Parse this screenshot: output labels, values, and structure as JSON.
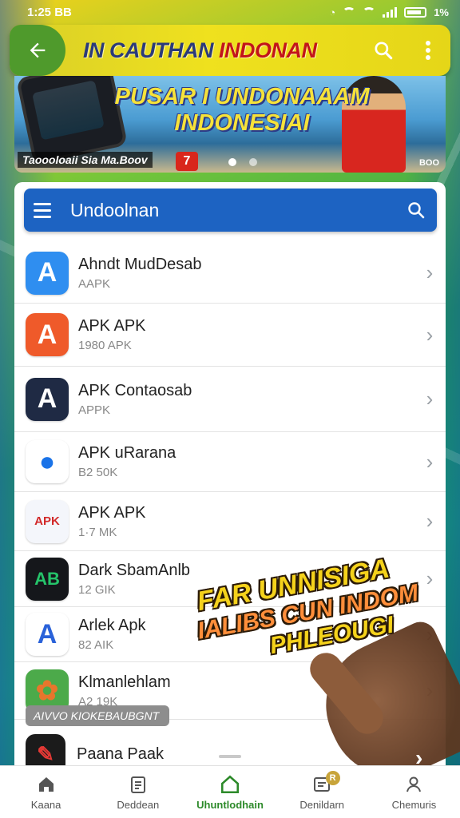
{
  "status_bar": {
    "time": "1:25 BB",
    "battery_text": "1%"
  },
  "app_bar": {
    "title_part1": "IN",
    "title_part2": " CAUTHAN ",
    "title_part3": "INDONAN",
    "back_icon": "arrow-left-icon",
    "search_icon": "search-icon",
    "more_icon": "more-vert-icon"
  },
  "banner": {
    "headline_line1": "PUSAR I UNDONAAAM",
    "headline_line2": "INDONESIAI",
    "caption": "Taoooloaii Sia Ma.Boov",
    "corner_text": "BOO",
    "logo_text": "7"
  },
  "search": {
    "title": "Undoolnan",
    "menu_icon": "menu-icon",
    "search_icon": "search-icon"
  },
  "apps": [
    {
      "name": "Ahndt MudDesab",
      "sub": "AAPK",
      "icon": "A",
      "bg": "#2f8ef0",
      "fg": "#ffffff"
    },
    {
      "name": "APK APK",
      "sub": "1980 APK",
      "icon": "A",
      "bg": "#ef5a2a",
      "fg": "#ffffff"
    },
    {
      "name": "APK Contaosab",
      "sub": "APPK",
      "icon": "A",
      "bg": "#1f2a44",
      "fg": "#ffffff"
    },
    {
      "name": "APK uRarana",
      "sub": "B2 50K",
      "icon": "●",
      "bg": "#ffffff",
      "fg": "#1a73e8"
    },
    {
      "name": "APK APK",
      "sub": "1·7 MK",
      "icon": "APK",
      "bg": "#f4f6fb",
      "fg": "#d22a2a"
    },
    {
      "name": "Dark SbamAnlb",
      "sub": "12 GIK",
      "icon": "AB",
      "bg": "#15171b",
      "fg": "#25c46a"
    },
    {
      "name": "Arlek Apk",
      "sub": "82 AIK",
      "icon": "A",
      "bg": "#ffffff",
      "fg": "#2a62d9"
    },
    {
      "name": "Klmanlehlam",
      "sub": "A2 19K",
      "icon": "✿",
      "bg": "#4caa4a",
      "fg": "#e8762c"
    }
  ],
  "section_label": "AIVVO KIOKEBAUBGNT",
  "last_app": {
    "name": "Paana Paak",
    "icon": "✎"
  },
  "sticker": {
    "line1": "FAR UNNISIGA",
    "line2": "IALIBS CUN INDOM",
    "line3": "PHLEOUGI"
  },
  "nav": [
    {
      "label": "Kaana",
      "icon": "home-icon"
    },
    {
      "label": "Deddean",
      "icon": "document-icon"
    },
    {
      "label": "Uhuntlodhain",
      "icon": "download-home-icon",
      "active": true
    },
    {
      "label": "Denildarn",
      "icon": "list-card-icon",
      "badge": "R"
    },
    {
      "label": "Chemuris",
      "icon": "profile-icon"
    }
  ],
  "colors": {
    "app_bar": "#efe11e",
    "accent_blue": "#1d63c2",
    "nav_active": "#2d8a2a"
  }
}
